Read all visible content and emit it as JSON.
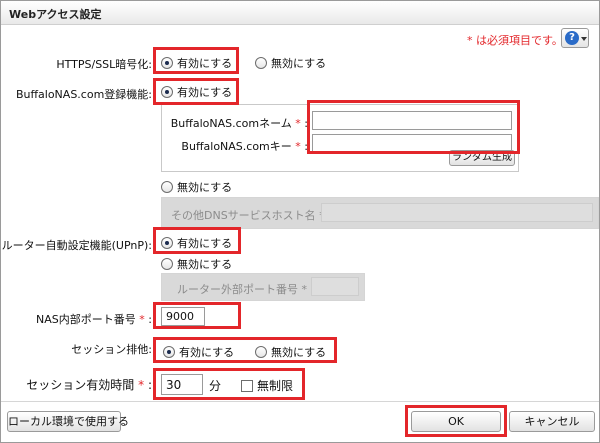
{
  "dialog": {
    "title": "Webアクセス設定",
    "required_note": "* は必須項目です。",
    "help_icon": "question-icon"
  },
  "https": {
    "label": "HTTPS/SSL暗号化:",
    "enable": "有効にする",
    "disable": "無効にする",
    "selected": "enable"
  },
  "buffalonas": {
    "label": "BuffaloNAS.com登録機能:",
    "enable": "有効にする",
    "name_label": "BuffaloNAS.comネーム",
    "name_value": "",
    "key_label": "BuffaloNAS.comキー",
    "key_value": "",
    "random_button": "ランダム生成",
    "disable": "無効にする",
    "other_dns_label": "その他DNSサービスホスト名",
    "star": "*",
    "colon": ":"
  },
  "upnp": {
    "label": "ルーター自動設定機能(UPnP):",
    "enable": "有効にする",
    "disable": "無効にする",
    "router_port_label": "ルーター外部ポート番号"
  },
  "nas_port": {
    "label": "NAS内部ポート番号",
    "value": "9000"
  },
  "session_lock": {
    "label": "セッション排他:",
    "enable": "有効にする",
    "disable": "無効にする"
  },
  "session_timeout": {
    "label": "セッション有効時間",
    "value": "30",
    "unit": "分",
    "unlimited": "無制限"
  },
  "footer": {
    "local_button": "ローカル環境で使用する",
    "ok_button": "OK",
    "cancel_button": "キャンセル"
  },
  "colors": {
    "highlight": "#e3262a",
    "required": "#e3262a",
    "help_blue": "#2a6bc8"
  }
}
